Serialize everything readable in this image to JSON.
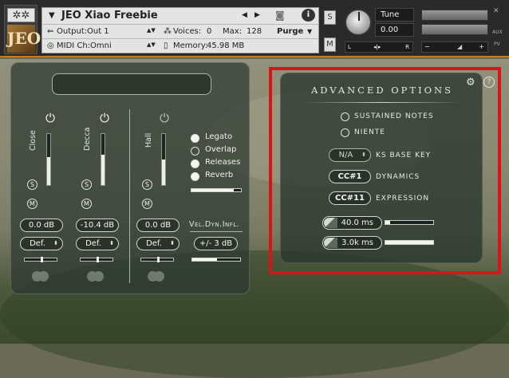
{
  "header": {
    "title": "JEO Xiao Freebie",
    "output_label": "Output:",
    "output_value": "Out 1",
    "voices_label": "Voices:",
    "voices_value": "0",
    "max_label": "Max:",
    "max_value": "128",
    "purge_label": "Purge",
    "midi_label": "MIDI Ch:",
    "midi_value": "Omni",
    "memory_label": "Memory:",
    "memory_value": "45.98 MB",
    "solo": "S",
    "mute": "M",
    "tune_label": "Tune",
    "tune_value": "0.00",
    "pan_l": "L",
    "pan_r": "R",
    "aux": "AUX",
    "pv": "PV",
    "logo_text": "JEO"
  },
  "mixer": {
    "channels": [
      {
        "name": "Close",
        "volume": "0.0 dB",
        "preset": "Def.",
        "level": 0.55
      },
      {
        "name": "Decca",
        "volume": "-10.4 dB",
        "preset": "Def.",
        "level": 0.6
      },
      {
        "name": "Hall",
        "volume": "0.0 dB",
        "preset": "Def.",
        "level": 0.5
      }
    ],
    "solo_label": "S",
    "mute_label": "M",
    "articulations": [
      {
        "label": "Legato",
        "selected": true
      },
      {
        "label": "Overlap",
        "selected": false
      },
      {
        "label": "Releases",
        "selected": true
      },
      {
        "label": "Reverb",
        "selected": true
      }
    ],
    "vel_dyn_label": "Vel.Dyn.Infl.",
    "vel_dyn_value": "+/- 3 dB"
  },
  "advanced": {
    "title": "ADVANCED OPTIONS",
    "sustained_notes": "SUSTAINED NOTES",
    "niente": "NIENTE",
    "ks_base_value": "N/A",
    "ks_base_label": "KS BASE KEY",
    "dynamics_value": "CC#1",
    "dynamics_label": "DYNAMICS",
    "expression_value": "CC#11",
    "expression_label": "EXPRESSION",
    "attack_value": "40.0 ms",
    "attack_level": 0.1,
    "release_value": "3.0k ms",
    "release_level": 1.0
  },
  "colors": {
    "highlight": "#d8141a",
    "accent": "#c97a1c"
  }
}
